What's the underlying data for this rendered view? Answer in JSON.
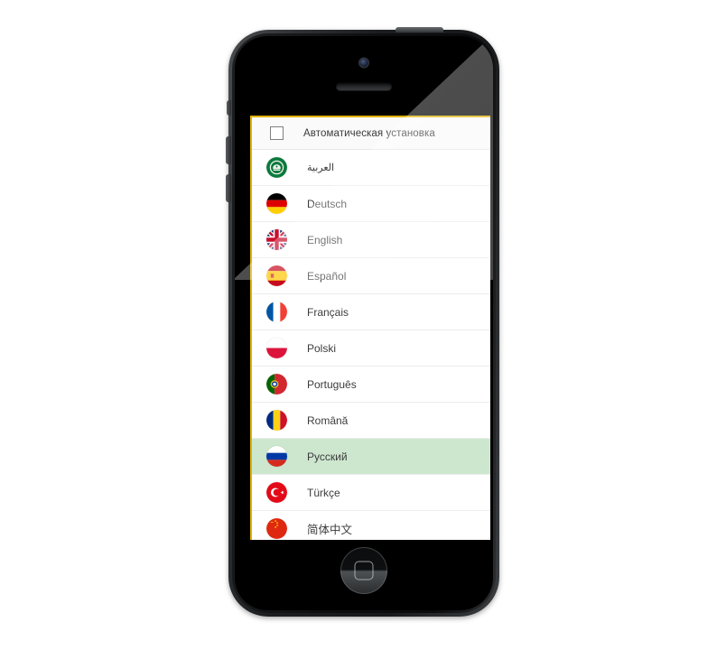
{
  "device": {
    "type": "smartphone",
    "frame_color": "#1b1d1f",
    "buttons": {
      "silent_switch": "silent-switch",
      "volume_up": "volume-up-button",
      "volume_down": "volume-down-button",
      "power": "power-button",
      "home": "home-button"
    }
  },
  "screen": {
    "accent_border_color": "#e0b200",
    "background": "#ffffff",
    "selected_row_color": "#cde7cf",
    "header": {
      "checkbox_checked": false,
      "label": "Автоматическая установка"
    },
    "languages": [
      {
        "label": "العربية",
        "flag": "arab-league-flag-icon",
        "rtl": true,
        "selected": false
      },
      {
        "label": "Deutsch",
        "flag": "germany-flag-icon",
        "rtl": false,
        "selected": false
      },
      {
        "label": "English",
        "flag": "united-kingdom-flag-icon",
        "rtl": false,
        "selected": false
      },
      {
        "label": "Español",
        "flag": "spain-flag-icon",
        "rtl": false,
        "selected": false
      },
      {
        "label": "Français",
        "flag": "france-flag-icon",
        "rtl": false,
        "selected": false
      },
      {
        "label": "Polski",
        "flag": "poland-flag-icon",
        "rtl": false,
        "selected": false
      },
      {
        "label": "Português",
        "flag": "portugal-flag-icon",
        "rtl": false,
        "selected": false
      },
      {
        "label": "Română",
        "flag": "romania-flag-icon",
        "rtl": false,
        "selected": false
      },
      {
        "label": "Русский",
        "flag": "russia-flag-icon",
        "rtl": false,
        "selected": true
      },
      {
        "label": "Türkçe",
        "flag": "turkey-flag-icon",
        "rtl": false,
        "selected": false
      },
      {
        "label": "简体中文",
        "flag": "china-flag-icon",
        "rtl": false,
        "selected": false
      }
    ]
  }
}
